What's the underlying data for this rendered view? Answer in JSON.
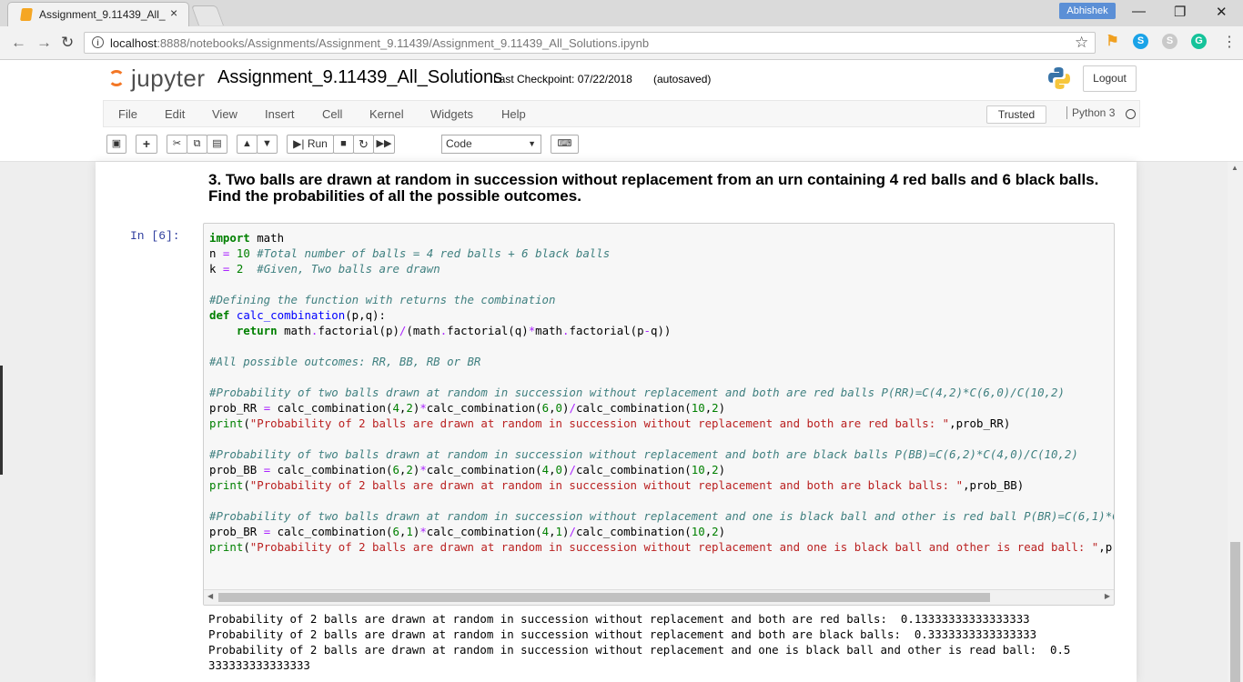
{
  "browser": {
    "tab_title": "Assignment_9.11439_All_",
    "tab_close": "×",
    "profile": "Abhishek",
    "url_host": "localhost",
    "url_rest": ":8888/notebooks/Assignments/Assignment_9.11439/Assignment_9.11439_All_Solutions.ipynb",
    "window_minimize": "—",
    "window_restore": "❐",
    "window_close": "✕"
  },
  "jupyter": {
    "logo_text": "jupyter",
    "notebook_name": "Assignment_9.11439_All_Solutions",
    "checkpoint": "Last Checkpoint: 07/22/2018",
    "autosave_status": "(autosaved)",
    "logout_label": "Logout",
    "menu": [
      "File",
      "Edit",
      "View",
      "Insert",
      "Cell",
      "Kernel",
      "Widgets",
      "Help"
    ],
    "trusted_label": "Trusted",
    "kernel_name": "Python 3",
    "toolbar": {
      "run_label": "Run",
      "cell_type": "Code"
    }
  },
  "notebook": {
    "question": "3. Two balls are drawn at random in succession without replacement from an urn containing 4 red balls and 6 black balls. Find the probabilities of all the possible outcomes.",
    "prompt": "In [6]:",
    "output_lines": [
      "Probability of 2 balls are drawn at random in succession without replacement and both are red balls:  0.13333333333333333",
      "Probability of 2 balls are drawn at random in succession without replacement and both are black balls:  0.3333333333333333",
      "Probability of 2 balls are drawn at random in succession without replacement and one is black ball and other is read ball:  0.5",
      "333333333333333"
    ]
  },
  "colors": {
    "jupyter_orange": "#f37726",
    "prompt_blue": "#303f9f",
    "keyword_green": "#008000",
    "comment_teal": "#408080",
    "string_red": "#ba2121"
  }
}
